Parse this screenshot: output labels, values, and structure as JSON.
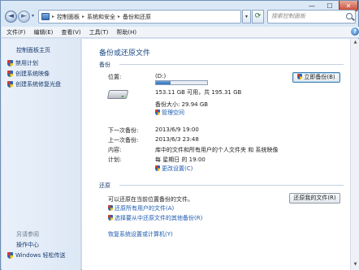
{
  "nav": {
    "back_glyph": "◄",
    "forward_glyph": "►",
    "history_glyph": "▾"
  },
  "address": {
    "breadcrumbs": [
      "控制面板",
      "系统和安全",
      "备份和还原"
    ],
    "separator": "▸"
  },
  "search": {
    "placeholder": "搜索控制面板"
  },
  "menu": [
    "文件(F)",
    "编辑(E)",
    "查看(V)",
    "工具(T)",
    "帮助(H)"
  ],
  "sidebar": {
    "home_link": "控制面板主页",
    "tasks": [
      "禁用计划",
      "创建系统映像",
      "创建系统修复光盘"
    ],
    "see_also_label": "另请参阅",
    "see_also": [
      "操作中心",
      "Windows 轻松传送"
    ]
  },
  "main": {
    "title": "备份或还原文件",
    "backup": {
      "section_label": "备份",
      "location_label": "位置:",
      "location_value": "(D:)",
      "usage_fraction": 0.28,
      "free_space": "153.11 GB 可用，共 195.31 GB",
      "backup_size": "备份大小: 29.94 GB",
      "manage_space": "管理空间",
      "backup_now_button": "立即备份(B)",
      "next_backup_label": "下一次备份:",
      "next_backup_value": "2013/6/9 19:00",
      "last_backup_label": "上一次备份:",
      "last_backup_value": "2013/6/3 23:48",
      "contents_label": "内容:",
      "contents_value": "库中的文件和所有用户的个人文件夹 和 系统映像",
      "schedule_label": "计划:",
      "schedule_value": "每 星期日 的 19:00",
      "change_settings": "更改设置(C)"
    },
    "restore": {
      "section_label": "还原",
      "description": "可以还原在当前位置备份的文件。",
      "restore_all_users": "还原所有用户的文件(A)",
      "select_other_backup": "选择要从中还原文件的其他备份(R)",
      "restore_my_files_button": "还原我的文件(R)",
      "recover_settings": "恢复系统设置或计算机(Y)"
    }
  },
  "window": {
    "close_glyph": "✕",
    "minimize_glyph": "—",
    "maximize_glyph": "☐"
  }
}
